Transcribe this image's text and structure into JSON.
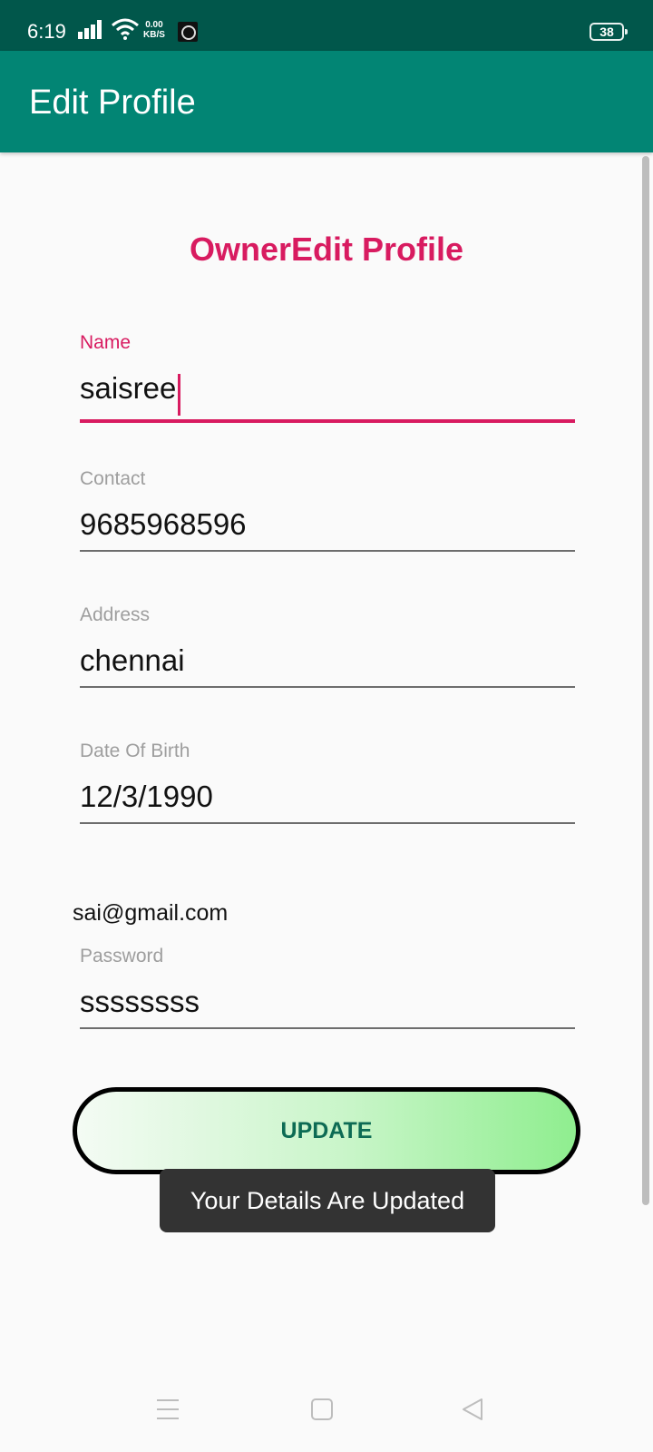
{
  "status_bar": {
    "time": "6:19",
    "net_speed_value": "0.00",
    "net_speed_unit": "KB/S",
    "battery": "38"
  },
  "app_bar": {
    "title": "Edit Profile"
  },
  "form": {
    "heading": "OwnerEdit Profile",
    "name": {
      "label": "Name",
      "value": "saisree"
    },
    "contact": {
      "label": "Contact",
      "value": "9685968596"
    },
    "address": {
      "label": "Address",
      "value": "chennai"
    },
    "dob": {
      "label": "Date Of Birth",
      "value": "12/3/1990"
    },
    "email": "sai@gmail.com",
    "password": {
      "label": "Password",
      "value": "ssssssss"
    },
    "update_label": "UPDATE"
  },
  "toast": {
    "message": "Your Details Are Updated"
  },
  "colors": {
    "status_bar": "#01574b",
    "app_bar": "#028574",
    "accent": "#d81b60",
    "button_text": "#0d6b54",
    "toast_bg": "#333333"
  },
  "icons": [
    "signal-icon",
    "wifi-icon",
    "app-notification-icon",
    "battery-icon",
    "menu-nav-icon",
    "home-nav-icon",
    "back-nav-icon"
  ]
}
